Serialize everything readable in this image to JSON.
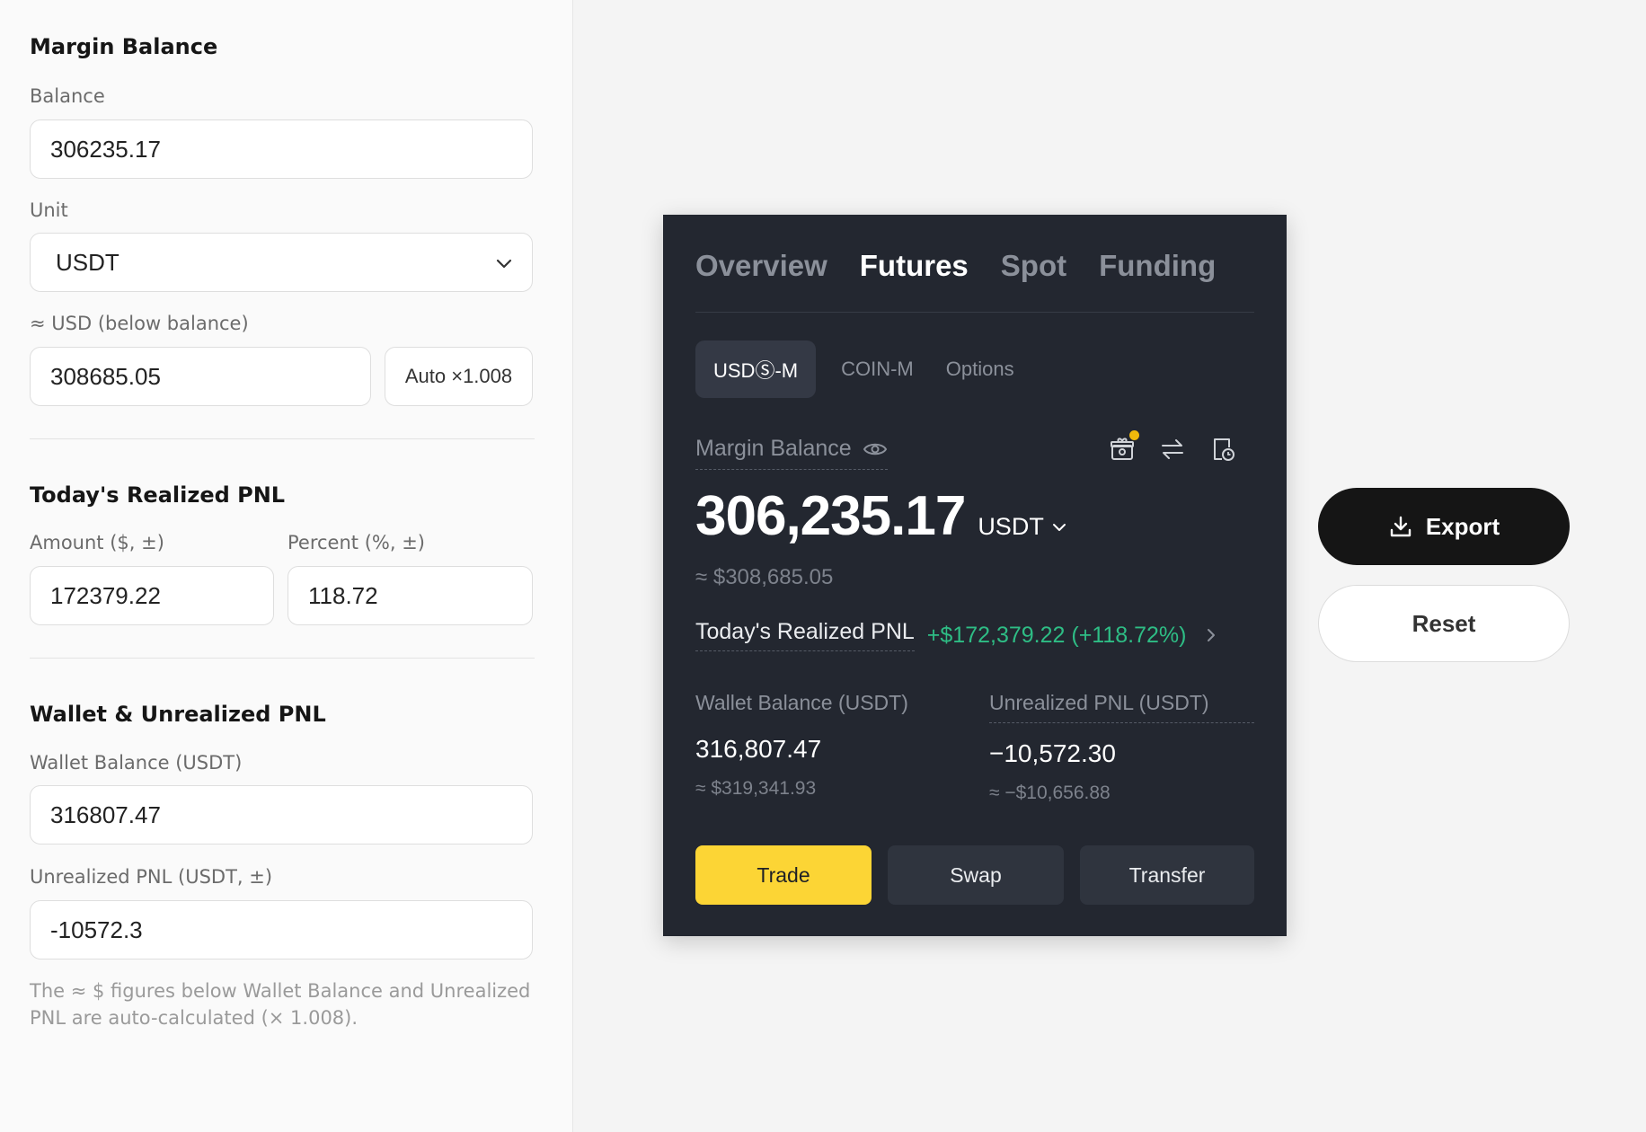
{
  "form": {
    "margin_section_title": "Margin Balance",
    "balance_label": "Balance",
    "balance_value": "306235.17",
    "unit_label": "Unit",
    "unit_value": "USDT",
    "usd_label": "≈ USD (below balance)",
    "usd_value": "308685.05",
    "auto_label": "Auto ×1.008",
    "pnl_section_title": "Today's Realized PNL",
    "amount_label": "Amount ($, ±)",
    "amount_value": "172379.22",
    "percent_label": "Percent (%, ±)",
    "percent_value": "118.72",
    "wallet_section_title": "Wallet & Unrealized PNL",
    "wallet_label": "Wallet Balance (USDT)",
    "wallet_value": "316807.47",
    "unrealized_label": "Unrealized PNL (USDT, ±)",
    "unrealized_value": "-10572.3",
    "note": "The ≈ $ figures below Wallet Balance and Unrealized PNL are auto-calculated (× 1.008)."
  },
  "card": {
    "tabs": [
      "Overview",
      "Futures",
      "Spot",
      "Funding"
    ],
    "active_tab": "Futures",
    "subtabs": [
      "USDⓈ-M",
      "COIN-M",
      "Options"
    ],
    "margin_label": "Margin Balance",
    "balance": "306,235.17",
    "unit": "USDT",
    "approx_usd": "≈ $308,685.05",
    "pnl_label": "Today's Realized PNL",
    "pnl_value": "+$172,379.22 (+118.72%)",
    "wallet_label": "Wallet Balance (USDT)",
    "wallet_value": "316,807.47",
    "wallet_usd": "≈ $319,341.93",
    "unrealized_label": "Unrealized PNL (USDT)",
    "unrealized_value": "−10,572.30",
    "unrealized_usd": "≈ −$10,656.88",
    "trade_label": "Trade",
    "swap_label": "Swap",
    "transfer_label": "Transfer"
  },
  "actions": {
    "export_label": "Export",
    "reset_label": "Reset"
  },
  "colors": {
    "card_bg": "#232730",
    "positive": "#2ebd85",
    "trade_yellow": "#fcd535",
    "notification_dot": "#f0b90b"
  },
  "icons": [
    "eye-icon",
    "gift-icon",
    "swap-arrows-icon",
    "history-document-icon",
    "chevron-down-icon",
    "chevron-right-icon",
    "download-icon"
  ]
}
